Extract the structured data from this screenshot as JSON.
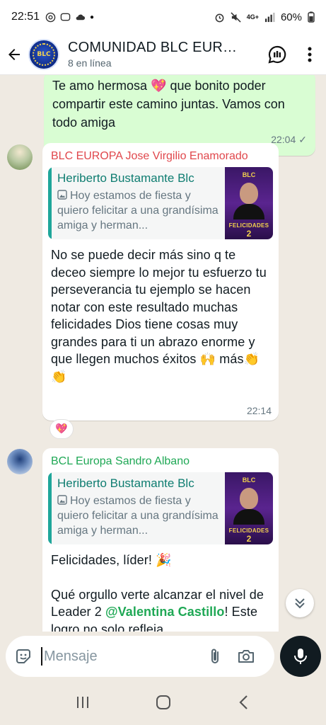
{
  "status_bar": {
    "time": "22:51",
    "battery": "60%",
    "network": "4G+"
  },
  "header": {
    "title": "COMUNIDAD BLC EURO...",
    "subtitle": "8 en línea",
    "avatar_text": "BLC"
  },
  "chat": {
    "outgoing": {
      "text": "Te amo hermosa 💖 que bonito poder compartir este camino juntas. Vamos con todo amiga",
      "time": "22:04"
    },
    "messages": [
      {
        "sender": "BLC EUROPA Jose Virgilio Enamorado",
        "sender_color": "#e0474c",
        "quote_author": "Heriberto Bustamante Blc",
        "quote_text": "Hoy estamos de fiesta y quiero felicitar a una grandísima amiga y herman...",
        "quote_image_text": "FELICIDADES",
        "quote_image_number": "2",
        "body": "No se puede decir más sino q te deceo siempre lo mejor tu esfuerzo  tu perseverancia  tu ejemplo   se hacen notar con este resultado  muchas felicidades Dios  tiene cosas muy grandes para ti un abrazo enorme y que llegen muchos éxitos 🙌 más👏 👏",
        "time": "22:14",
        "reaction": "💖"
      },
      {
        "sender": "BCL Europa Sandro Albano",
        "sender_color": "#1fa855",
        "quote_author": "Heriberto Bustamante Blc",
        "quote_text": "Hoy estamos de fiesta y quiero felicitar a una grandísima amiga y herman...",
        "quote_image_text": "FELICIDADES",
        "quote_image_number": "2",
        "body_line1": "Felicidades, líder! 🎉",
        "body_line2_pre": "Qué orgullo verte alcanzar el nivel de Leader 2 ",
        "body_mention": "@Valentina Castillo",
        "body_line2_post": "! Este logro no solo refleja"
      }
    ]
  },
  "composer": {
    "placeholder": "Mensaje"
  },
  "icons": {
    "back": "arrow-left-icon",
    "community": "community-chat-icon",
    "menu": "more-vert-icon",
    "sticker": "sticker-icon",
    "attach": "paperclip-icon",
    "camera": "camera-icon",
    "mic": "mic-icon",
    "scroll": "double-chevron-down-icon"
  },
  "colors": {
    "header_bg": "#ffffff",
    "chat_bg": "#efeae2",
    "outgoing_bubble": "#d9fdd3",
    "accent_green": "#1fa855",
    "quote_bar": "#1fa69a"
  }
}
